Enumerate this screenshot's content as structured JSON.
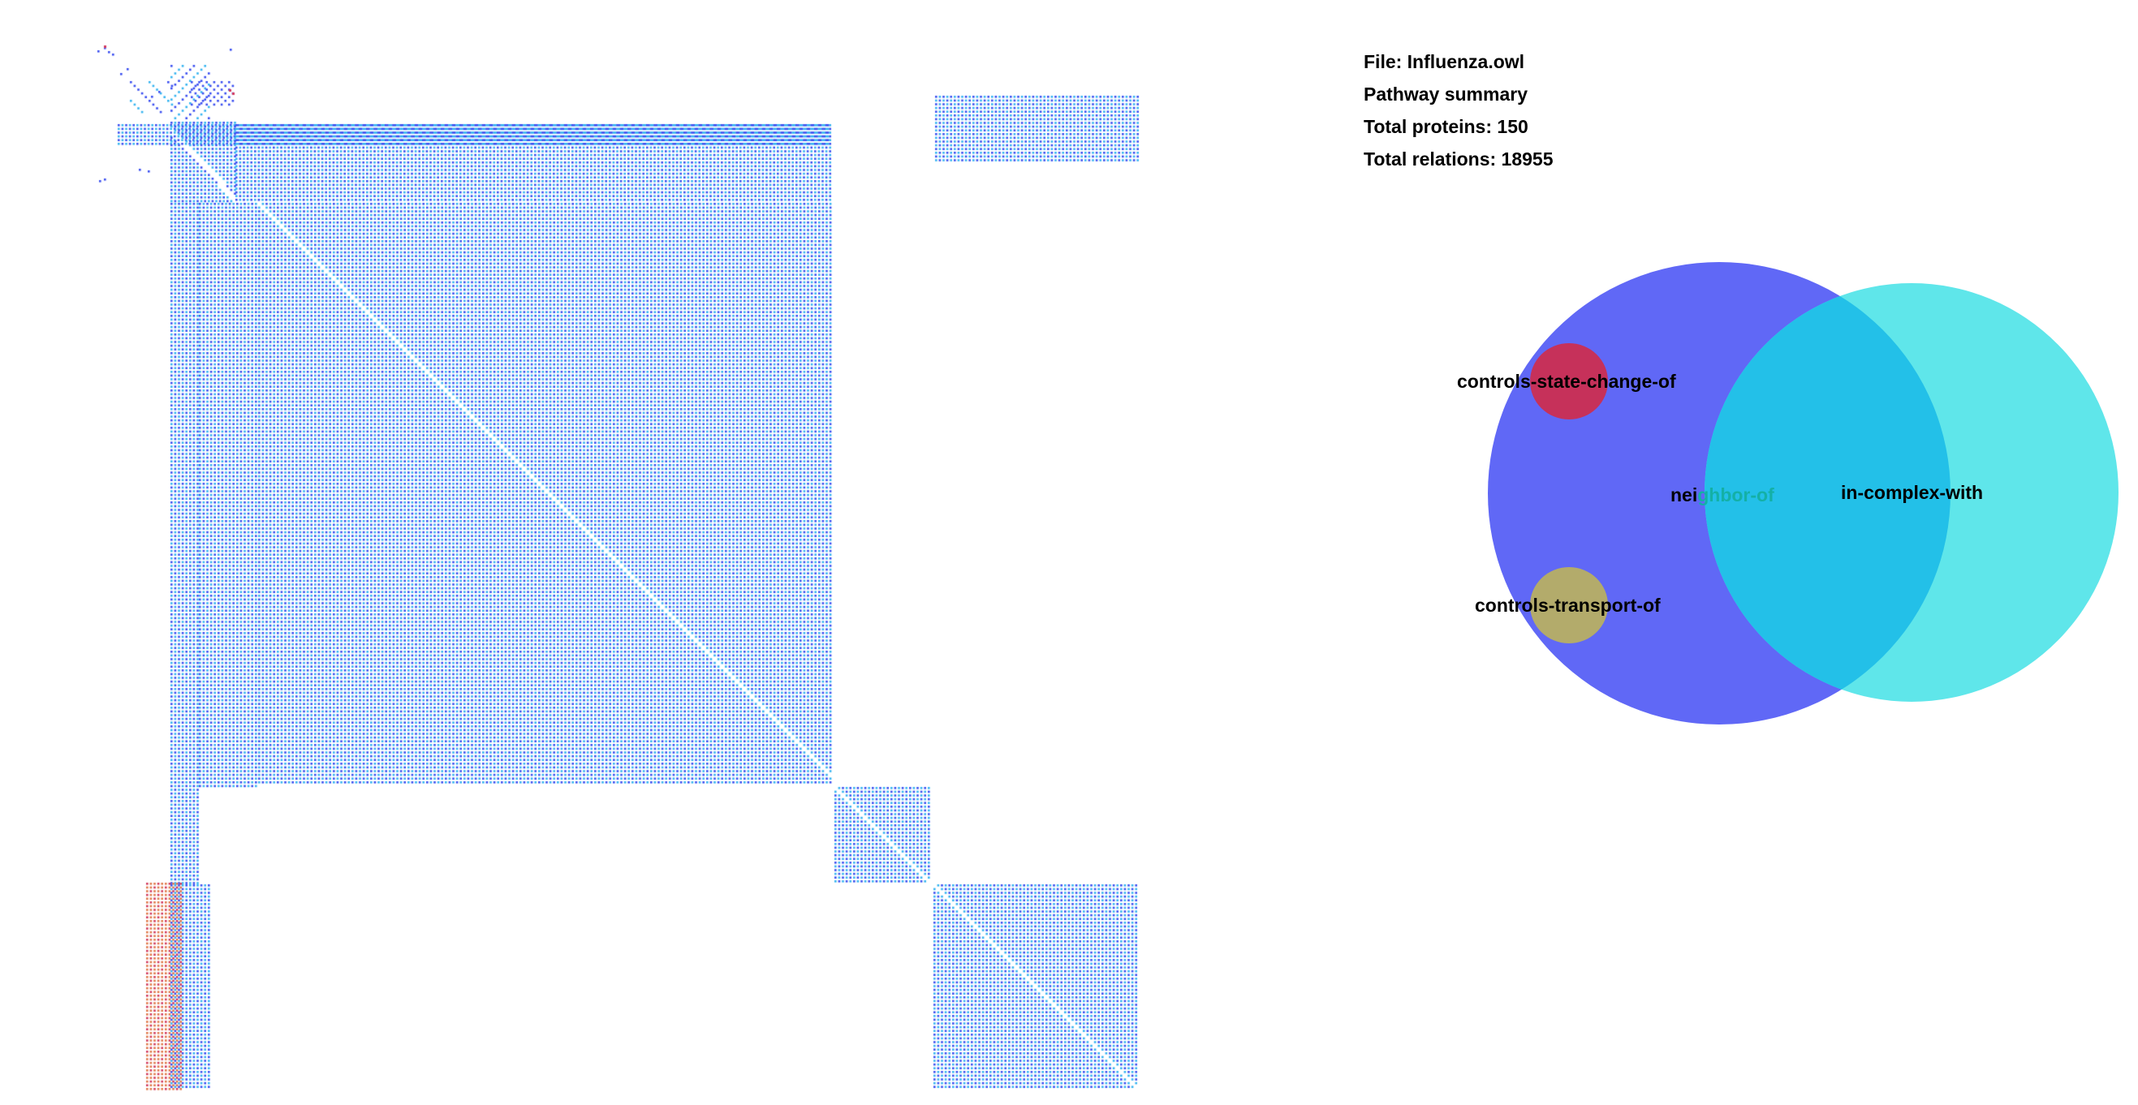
{
  "summary": {
    "file": "File: Influenza.owl",
    "title": "Pathway summary",
    "proteins": "Total proteins: 150",
    "relations": "Total relations: 18955"
  },
  "venn": {
    "sets": [
      {
        "label": "neighbor-of",
        "color": "#6068f6"
      },
      {
        "label": "in-complex-with",
        "color": "#5fe6ea"
      },
      {
        "label": "controls-state-change-of",
        "color": "#c6315a"
      },
      {
        "label": "controls-transport-of",
        "color": "#b3ab6b"
      }
    ],
    "intersection_color": "#23c0e8"
  },
  "matrix": {
    "colors": {
      "neighbor_of": "#3a4ef0",
      "in_complex_with": "#36b4f0",
      "controls_state_change_of": "#d23a5e",
      "controls_transport_of": "#e07a4c"
    }
  }
}
